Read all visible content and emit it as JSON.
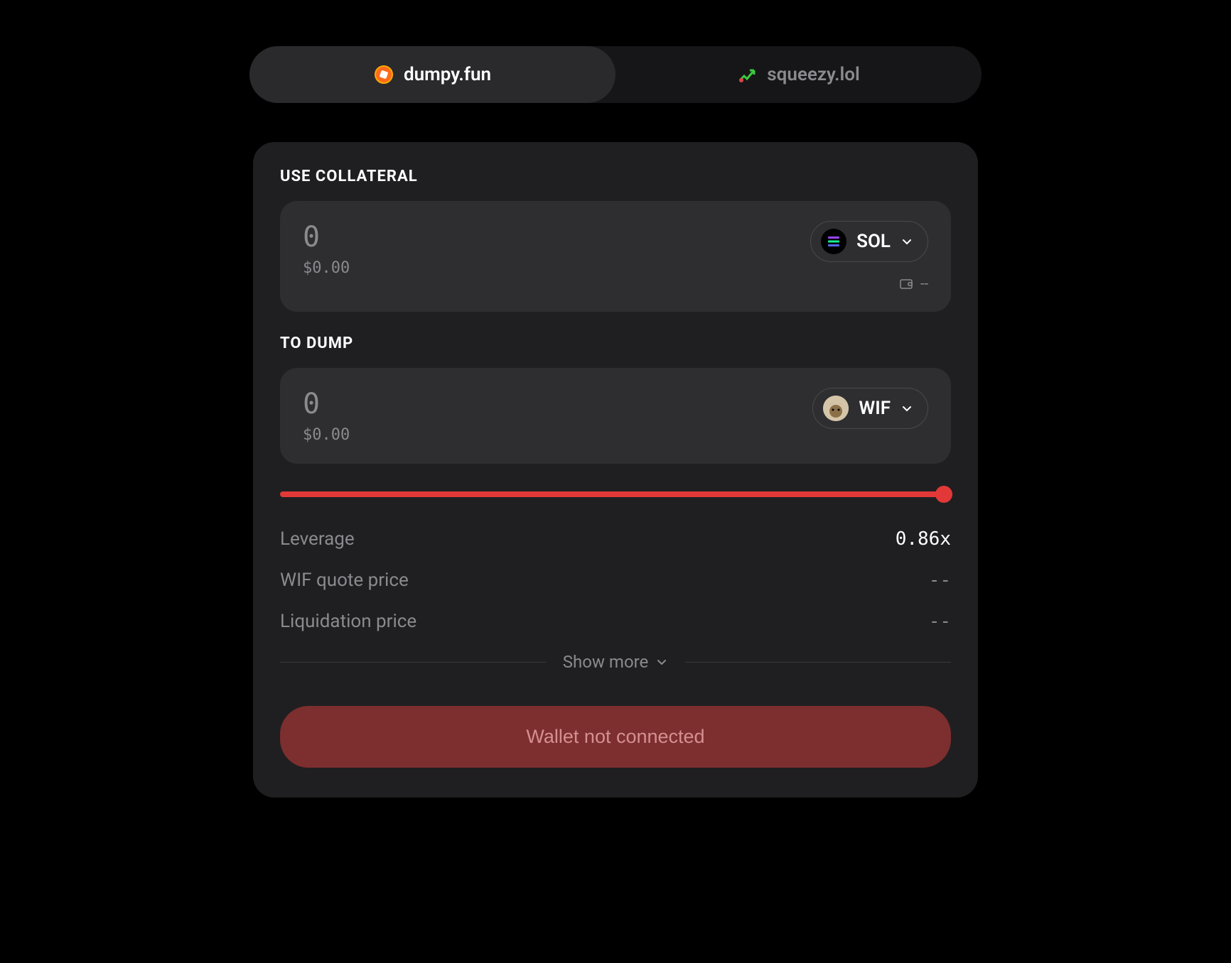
{
  "tabs": {
    "dumpy": {
      "label": "dumpy.fun",
      "icon": "dumpy-icon"
    },
    "squeezy": {
      "label": "squeezy.lol",
      "icon": "squeezy-icon"
    }
  },
  "collateral": {
    "label": "USE COLLATERAL",
    "amount": "0",
    "usd": "$0.00",
    "token": "SOL",
    "balance": "--"
  },
  "dump": {
    "label": "TO DUMP",
    "amount": "0",
    "usd": "$0.00",
    "token": "WIF"
  },
  "info": {
    "leverage_label": "Leverage",
    "leverage_value": "0.86x",
    "quote_label": "WIF quote price",
    "quote_value": "--",
    "liquidation_label": "Liquidation price",
    "liquidation_value": "--"
  },
  "show_more": "Show more",
  "button": "Wallet not connected",
  "colors": {
    "accent": "#e23838"
  }
}
